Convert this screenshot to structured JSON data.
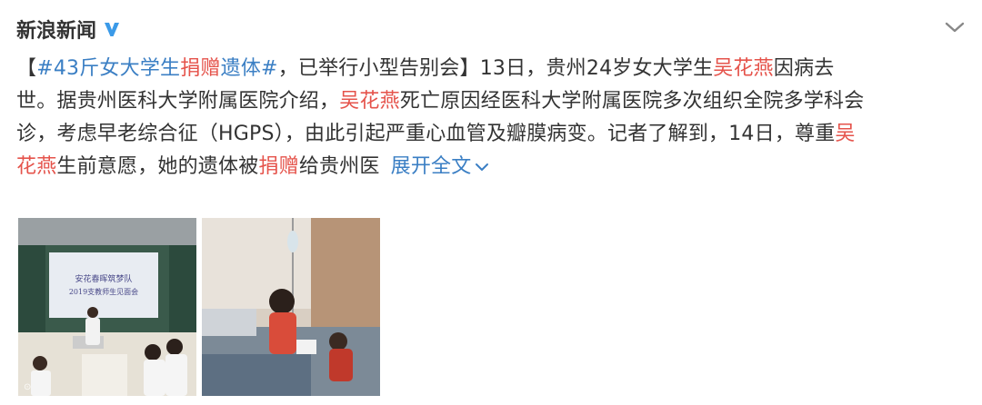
{
  "post": {
    "username": "新浪新闻",
    "verified_icon": "verified-v-icon",
    "menu_icon": "chevron-down-icon",
    "text": {
      "l1_bracket_open": "【",
      "l1_hashtag_part1": "#43斤女大学生",
      "l1_hashtag_red": "捐赠",
      "l1_hashtag_part2": "遗体#",
      "l1_text1": "，已举行小型告别会】13日，贵州24岁女大学生",
      "l1_name": "吴花燕",
      "l1_text2": "因病去",
      "l2_text1": "世。据贵州医科大学附属医院介绍，",
      "l2_name": "吴花燕",
      "l2_text2": "死亡原因经医科大学附属医院多次组织全院多学科会",
      "l3_text1": "诊，考虑早老综合征（HGPS），由此引起严重心血管及瓣膜病变。记者了解到，14日，尊重",
      "l3_name_part1": "吴",
      "l4_name_part2": "花燕",
      "l4_text1": "生前意愿，她的遗体被",
      "l4_donate": "捐赠",
      "l4_text2": "给贵州医",
      "expand_label": "展开全文"
    },
    "colors": {
      "link_blue": "#3b7fc4",
      "highlight_red": "#e5534b"
    },
    "images": [
      {
        "name": "classroom-photo",
        "slide_line1": "安花春晖筑梦队",
        "slide_line2": "2019支教师生见面会",
        "watermark": ""
      },
      {
        "name": "hospital-photo",
        "watermark": ""
      }
    ]
  }
}
